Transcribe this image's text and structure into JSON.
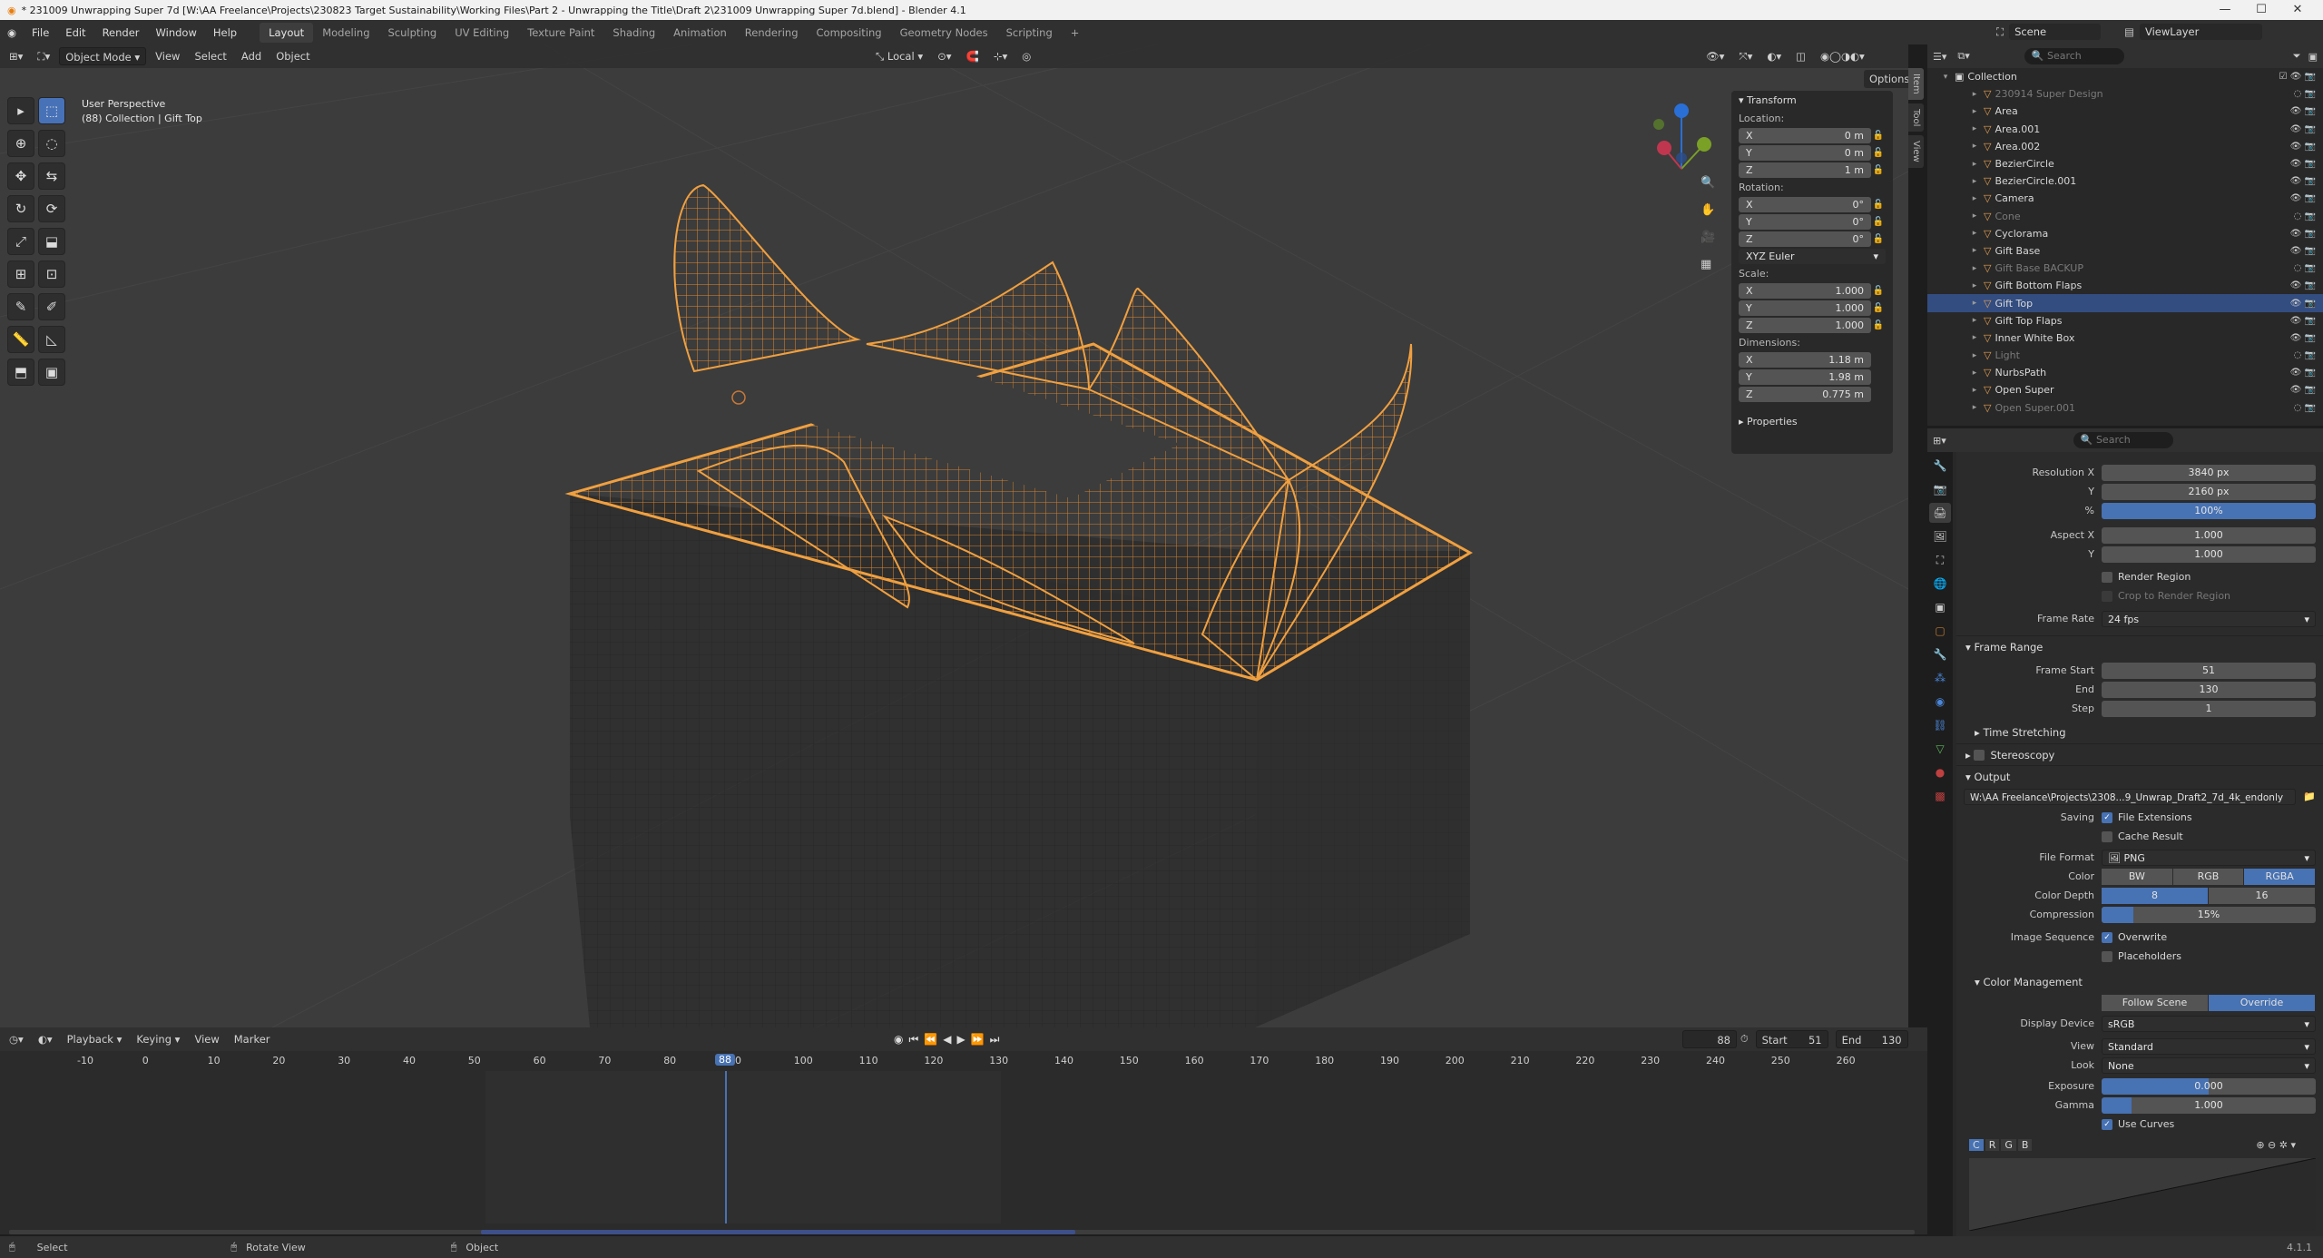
{
  "titlebar": {
    "title": "* 231009 Unwrapping Super 7d [W:\\AA Freelance\\Projects\\230823 Target Sustainability\\Working Files\\Part 2 - Unwrapping the Title\\Draft 2\\231009 Unwrapping Super 7d.blend] - Blender 4.1"
  },
  "menus": [
    "File",
    "Edit",
    "Render",
    "Window",
    "Help"
  ],
  "workspaces": [
    "Layout",
    "Modeling",
    "Sculpting",
    "UV Editing",
    "Texture Paint",
    "Shading",
    "Animation",
    "Rendering",
    "Compositing",
    "Geometry Nodes",
    "Scripting"
  ],
  "active_workspace": "Layout",
  "scene": {
    "label": "Scene",
    "view_layer": "ViewLayer"
  },
  "viewport_header": {
    "mode": "Object Mode",
    "menus": [
      "View",
      "Select",
      "Add",
      "Object"
    ],
    "transform_orientation": "Local",
    "options": "Options"
  },
  "viewport_overlay": {
    "perspective": "User Perspective",
    "collection_info": "(88) Collection | Gift Top"
  },
  "npanel": {
    "transform_title": "Transform",
    "location_label": "Location:",
    "location": [
      {
        "axis": "X",
        "value": "0 m"
      },
      {
        "axis": "Y",
        "value": "0 m"
      },
      {
        "axis": "Z",
        "value": "1 m"
      }
    ],
    "rotation_label": "Rotation:",
    "rotation": [
      {
        "axis": "X",
        "value": "0°"
      },
      {
        "axis": "Y",
        "value": "0°"
      },
      {
        "axis": "Z",
        "value": "0°"
      }
    ],
    "rotation_mode": "XYZ Euler",
    "scale_label": "Scale:",
    "scale": [
      {
        "axis": "X",
        "value": "1.000"
      },
      {
        "axis": "Y",
        "value": "1.000"
      },
      {
        "axis": "Z",
        "value": "1.000"
      }
    ],
    "dimensions_label": "Dimensions:",
    "dimensions": [
      {
        "axis": "X",
        "value": "1.18 m"
      },
      {
        "axis": "Y",
        "value": "1.98 m"
      },
      {
        "axis": "Z",
        "value": "0.775 m"
      }
    ],
    "properties_title": "Properties"
  },
  "side_tabs": [
    "Item",
    "Tool",
    "View"
  ],
  "outliner": {
    "search_placeholder": "Search",
    "root": "Collection",
    "items": [
      {
        "name": "230914 Super Design",
        "dim": true,
        "selected": false
      },
      {
        "name": "Area",
        "dim": false,
        "selected": false
      },
      {
        "name": "Area.001",
        "dim": false,
        "selected": false
      },
      {
        "name": "Area.002",
        "dim": false,
        "selected": false
      },
      {
        "name": "BezierCircle",
        "dim": false,
        "selected": false
      },
      {
        "name": "BezierCircle.001",
        "dim": false,
        "selected": false
      },
      {
        "name": "Camera",
        "dim": false,
        "selected": false
      },
      {
        "name": "Cone",
        "dim": true,
        "selected": false
      },
      {
        "name": "Cyclorama",
        "dim": false,
        "selected": false
      },
      {
        "name": "Gift Base",
        "dim": false,
        "selected": false
      },
      {
        "name": "Gift Base BACKUP",
        "dim": true,
        "selected": false
      },
      {
        "name": "Gift Bottom Flaps",
        "dim": false,
        "selected": false
      },
      {
        "name": "Gift Top",
        "dim": false,
        "selected": true
      },
      {
        "name": "Gift Top Flaps",
        "dim": false,
        "selected": false
      },
      {
        "name": "Inner White Box",
        "dim": false,
        "selected": false
      },
      {
        "name": "Light",
        "dim": true,
        "selected": false
      },
      {
        "name": "NurbsPath",
        "dim": false,
        "selected": false
      },
      {
        "name": "Open Super",
        "dim": false,
        "selected": false
      },
      {
        "name": "Open Super.001",
        "dim": true,
        "selected": false
      }
    ]
  },
  "properties": {
    "search_placeholder": "Search",
    "resolution_x_label": "Resolution X",
    "resolution_x": "3840 px",
    "resolution_y_label": "Y",
    "resolution_y": "2160 px",
    "percent_label": "%",
    "percent": "100%",
    "aspect_x_label": "Aspect X",
    "aspect_x": "1.000",
    "aspect_y_label": "Y",
    "aspect_y": "1.000",
    "render_region": "Render Region",
    "crop_region": "Crop to Render Region",
    "frame_rate_label": "Frame Rate",
    "frame_rate": "24 fps",
    "frame_range_title": "Frame Range",
    "frame_start_label": "Frame Start",
    "frame_start": "51",
    "end_label": "End",
    "end": "130",
    "step_label": "Step",
    "step": "1",
    "time_stretching": "Time Stretching",
    "stereoscopy": "Stereoscopy",
    "output_title": "Output",
    "output_path": "W:\\AA Freelance\\Projects\\2308...9_Unwrap_Draft2_7d_4k_endonly",
    "saving_label": "Saving",
    "file_extensions": "File Extensions",
    "cache_result": "Cache Result",
    "file_format_label": "File Format",
    "file_format": "PNG",
    "color_label": "Color",
    "color_options": [
      "BW",
      "RGB",
      "RGBA"
    ],
    "color_selected": "RGBA",
    "color_depth_label": "Color Depth",
    "color_depth_options": [
      "8",
      "16"
    ],
    "color_depth_selected": "8",
    "compression_label": "Compression",
    "compression": "15%",
    "compression_fraction": 0.15,
    "image_sequence_label": "Image Sequence",
    "overwrite": "Overwrite",
    "placeholders": "Placeholders",
    "color_management_title": "Color Management",
    "cm_options": [
      "Follow Scene",
      "Override"
    ],
    "cm_selected": "Override",
    "display_device_label": "Display Device",
    "display_device": "sRGB",
    "view_label": "View",
    "view": "Standard",
    "look_label": "Look",
    "look": "None",
    "exposure_label": "Exposure",
    "exposure": "0.000",
    "gamma_label": "Gamma",
    "gamma": "1.000",
    "use_curves": "Use Curves",
    "curve_channels": [
      "C",
      "R",
      "G",
      "B"
    ]
  },
  "timeline": {
    "menus": [
      "Playback",
      "Keying",
      "View",
      "Marker"
    ],
    "current_frame": "88",
    "start_label": "Start",
    "start": "51",
    "end_label": "End",
    "end": "130",
    "ruler_ticks": [
      "-10",
      "0",
      "10",
      "20",
      "30",
      "40",
      "50",
      "60",
      "70",
      "80",
      "90",
      "100",
      "110",
      "120",
      "130",
      "140",
      "150",
      "160",
      "170",
      "180",
      "190",
      "200",
      "210",
      "220",
      "230",
      "240",
      "250",
      "260"
    ]
  },
  "statusbar": {
    "items": [
      "Select",
      "Rotate View",
      "Object"
    ],
    "version": "4.1.1"
  },
  "colors": {
    "accent": "#4772b3",
    "selection": "#e8a050",
    "viewport_bg": "#3c3c3c",
    "panel_bg": "#303030"
  }
}
